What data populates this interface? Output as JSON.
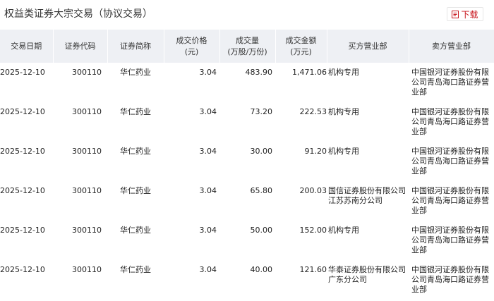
{
  "page": {
    "title": "权益类证券大宗交易（协议交易）",
    "download_label": "下载"
  },
  "table": {
    "headers": [
      [
        "交易日期"
      ],
      [
        "证券代码"
      ],
      [
        "证券简称"
      ],
      [
        "成交价格",
        "(元)"
      ],
      [
        "成交量",
        "(万股/万份)"
      ],
      [
        "成交金额",
        "(万元)"
      ],
      [
        "买方营业部"
      ],
      [
        "卖方营业部"
      ]
    ],
    "rows": [
      [
        "2025-12-10",
        "300110",
        "华仁药业",
        "3.04",
        "483.90",
        "1,471.06",
        "机构专用",
        "中国银河证券股份有限公司青岛海口路证券营业部"
      ],
      [
        "2025-12-10",
        "300110",
        "华仁药业",
        "3.04",
        "73.20",
        "222.53",
        "机构专用",
        "中国银河证券股份有限公司青岛海口路证券营业部"
      ],
      [
        "2025-12-10",
        "300110",
        "华仁药业",
        "3.04",
        "30.00",
        "91.20",
        "机构专用",
        "中国银河证券股份有限公司青岛海口路证券营业部"
      ],
      [
        "2025-12-10",
        "300110",
        "华仁药业",
        "3.04",
        "65.80",
        "200.03",
        "国信证券股份有限公司江苏苏南分公司",
        "中国银河证券股份有限公司青岛海口路证券营业部"
      ],
      [
        "2025-12-10",
        "300110",
        "华仁药业",
        "3.04",
        "50.00",
        "152.00",
        "机构专用",
        "中国银河证券股份有限公司青岛海口路证券营业部"
      ],
      [
        "2025-12-10",
        "300110",
        "华仁药业",
        "3.04",
        "40.00",
        "121.60",
        "华泰证券股份有限公司广东分公司",
        "中国银河证券股份有限公司青岛海口路证券营业部"
      ]
    ]
  },
  "colors": {
    "accent": "#c8161d",
    "header_bg": "#eef0f4"
  },
  "icons": {
    "download": "file-download-icon"
  }
}
